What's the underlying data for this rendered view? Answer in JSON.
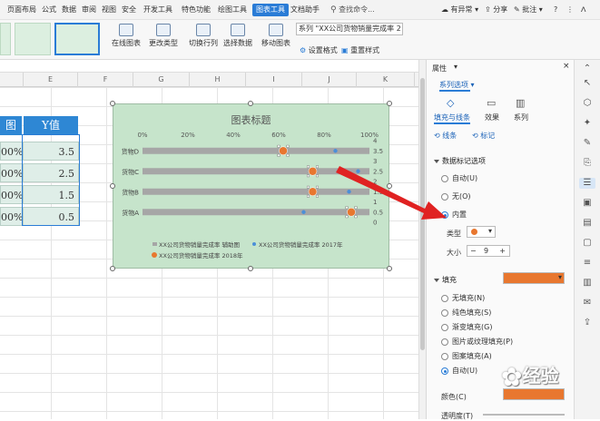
{
  "menubar": {
    "items": [
      "页面布局",
      "公式",
      "数据",
      "审阅",
      "视图",
      "安全",
      "开发工具",
      "特色功能",
      "绘图工具",
      "图表工具",
      "文档助手"
    ],
    "active": "图表工具",
    "search_placeholder": "查找命令...",
    "right": {
      "status": "有异常",
      "share": "分享",
      "comment": "批注"
    }
  },
  "ribbon": {
    "buttons": {
      "online_chart": "在线图表",
      "change_type": "更改类型",
      "switch_rowcol": "切换行列",
      "select_data": "选择数据",
      "move_chart": "移动图表",
      "set_format": "设置格式",
      "reset_style": "重置样式"
    },
    "series_select": "系列 \"XX公司货物销量完成率 2"
  },
  "sheet": {
    "columns": [
      "E",
      "F",
      "G",
      "H",
      "I",
      "J",
      "K"
    ],
    "header_partial": "图",
    "y_header": "Y值",
    "rows": [
      {
        "pct": "00%",
        "y": "3.5"
      },
      {
        "pct": "00%",
        "y": "2.5"
      },
      {
        "pct": "00%",
        "y": "1.5"
      },
      {
        "pct": "00%",
        "y": "0.5"
      }
    ]
  },
  "chart": {
    "title": "图表标题",
    "legend": [
      {
        "label": "XX公司货物销量完成率 辅助图",
        "color": "#a6a6a6"
      },
      {
        "label": "XX公司货物销量完成率 2017年",
        "color": "#4b8fd8"
      },
      {
        "label": "XX公司货物销量完成率 2018年",
        "color": "#e8772f"
      }
    ]
  },
  "chart_data": {
    "type": "bar",
    "orientation": "horizontal",
    "title": "图表标题",
    "categories": [
      "货物A",
      "货物B",
      "货物C",
      "货物D"
    ],
    "x_ticks": [
      "0%",
      "20%",
      "40%",
      "60%",
      "80%",
      "100%"
    ],
    "y2_ticks": [
      "0",
      "0.5",
      "1",
      "1.5",
      "2",
      "2.5",
      "3",
      "3.5",
      "4"
    ],
    "xlim": [
      0,
      1
    ],
    "y2lim": [
      0,
      4
    ],
    "series": [
      {
        "name": "XX公司货物销量完成率 辅助图",
        "values": [
          1,
          1,
          1,
          1
        ],
        "color": "#a6a6a6"
      },
      {
        "name": "XX公司货物销量完成率 2017年",
        "x": [
          0.71,
          0.91,
          0.95,
          0.85
        ],
        "y": [
          0.5,
          1.5,
          2.5,
          3.5
        ],
        "color": "#4b8fd8"
      },
      {
        "name": "XX公司货物销量完成率 2018年",
        "x": [
          0.92,
          0.75,
          0.75,
          0.62
        ],
        "y": [
          0.5,
          1.5,
          2.5,
          3.5
        ],
        "color": "#e8772f"
      }
    ],
    "legend_position": "bottom"
  },
  "panel": {
    "title": "属性",
    "dropdown": "系列选项",
    "tabs": [
      "填充与线条",
      "效果",
      "系列"
    ],
    "subtabs": [
      "线条",
      "标记"
    ],
    "marker_section": "数据标记选项",
    "marker_options": [
      "自动(U)",
      "无(O)",
      "内置"
    ],
    "marker_selected": "内置",
    "type_label": "类型",
    "size_label": "大小",
    "size_value": "9",
    "fill_section": "填充",
    "fill_color": "#e8772f",
    "fill_options": [
      "无填充(N)",
      "纯色填充(S)",
      "渐变填充(G)",
      "图片或纹理填充(P)",
      "图案填充(A)",
      "自动(U)"
    ],
    "fill_selected": "自动(U)",
    "color_label": "颜色(C)",
    "transparency_label": "透明度(T)"
  },
  "watermark": "经验"
}
